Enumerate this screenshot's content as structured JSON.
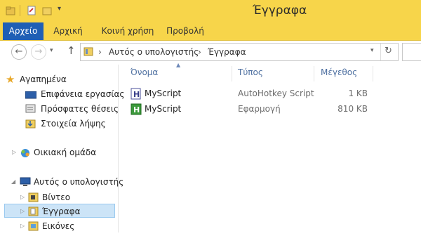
{
  "window": {
    "title": "Έγγραφα"
  },
  "ribbon": {
    "tabs": [
      {
        "label": "Αρχείο"
      },
      {
        "label": "Αρχική"
      },
      {
        "label": "Κοινή χρήση"
      },
      {
        "label": "Προβολή"
      }
    ]
  },
  "address": {
    "segments": [
      "Αυτός ο υπολογιστής",
      "Έγγραφα"
    ],
    "separator": "›"
  },
  "nav": {
    "favorites": "Αγαπημένα",
    "desktop": "Επιφάνεια εργασίας",
    "recent": "Πρόσφατες θέσεις",
    "downloads": "Στοιχεία λήψης",
    "homegroup": "Οικιακή ομάδα",
    "thispc": "Αυτός ο υπολογιστής",
    "videos": "Βίντεο",
    "documents": "Έγγραφα",
    "pictures": "Εικόνες"
  },
  "columns": {
    "name": "Όνομα",
    "type": "Τύπος",
    "size": "Μέγεθος"
  },
  "files": [
    {
      "name": "MyScript",
      "type": "AutoHotkey Script",
      "size": "1 KB",
      "icon": "ahk-script-icon"
    },
    {
      "name": "MyScript",
      "type": "Εφαρμογή",
      "size": "810 KB",
      "icon": "ahk-exe-icon"
    }
  ],
  "colors": {
    "titlebar": "#f7d54a",
    "file_tab": "#1f5fb5",
    "selection": "#cce4f7"
  }
}
